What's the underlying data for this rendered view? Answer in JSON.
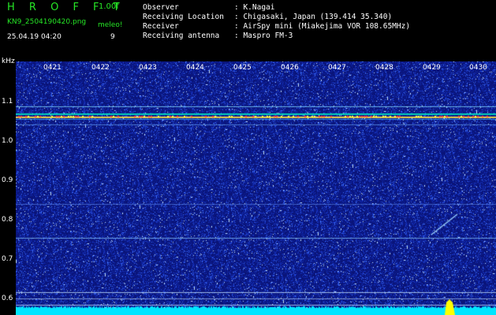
{
  "header": {
    "app_title": "H R O F F T",
    "version": "1.00f",
    "filename": "KN9_2504190420.png",
    "datetime": "25.04.19 04:20",
    "meleo_label": "meleo!",
    "meleo_value": "9",
    "info": [
      {
        "key": "Observer",
        "value": ": K.Nagai"
      },
      {
        "key": "Receiving Location",
        "value": ": Chigasaki, Japan (139.414 35.340)"
      },
      {
        "key": "Receiver",
        "value": ": AirSpy mini (Miakejima VOR 108.65MHz)"
      },
      {
        "key": "Receiving antenna",
        "value": ": Maspro FM-3"
      }
    ]
  },
  "spectrogram": {
    "unit_label": "kHz",
    "freq_ticks": [
      "1.1",
      "1.0",
      "0.9",
      "0.8",
      "0.7",
      "0.6"
    ],
    "time_ticks": [
      "0421",
      "0422",
      "0423",
      "0424",
      "0425",
      "0426",
      "0427",
      "0428",
      "0429",
      "0430"
    ],
    "colors": {
      "background": "#0a1478",
      "noise": "#3c64ff",
      "signal": "#ffff00",
      "baseline": "#00e5ff"
    }
  }
}
